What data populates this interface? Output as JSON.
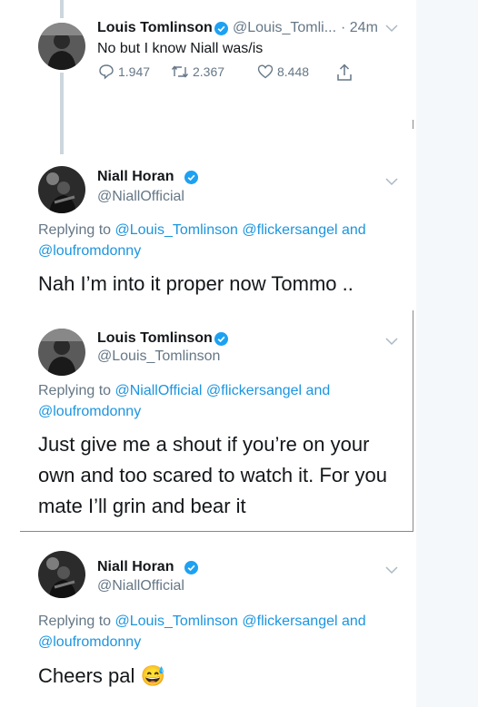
{
  "tweets": [
    {
      "name": "Louis Tomlinson",
      "handle": "@Louis_Tomli...",
      "time": "· 24m",
      "text": "No but I know Niall was/is",
      "actions": {
        "replies": "1.947",
        "retweets": "2.367",
        "likes": "8.448"
      }
    },
    {
      "name": "Niall Horan",
      "handle": "@NiallOfficial",
      "replying_prefix": "Replying to",
      "replying_to_1": "@Louis_Tomlinson",
      "replying_to_2": "@flickersangel",
      "replying_and": "and",
      "replying_to_3": "@loufromdonny",
      "text": "Nah I’m into it proper now Tommo .."
    },
    {
      "name": "Louis Tomlinson",
      "handle": "@Louis_Tomlinson",
      "replying_prefix": "Replying to",
      "replying_to_1": "@NiallOfficial",
      "replying_to_2": "@flickersangel",
      "replying_and": "and",
      "replying_to_3": "@loufromdonny",
      "text_lines": [
        "Just give me a shout if you’re on your",
        "own and too scared to watch it. For you",
        "mate I’ll grin and bear it"
      ]
    },
    {
      "name": "Niall Horan",
      "handle": "@NiallOfficial",
      "replying_prefix": "Replying to",
      "replying_to_1": "@Louis_Tomlinson",
      "replying_to_2": "@flickersangel",
      "replying_and": "and",
      "replying_to_3": "@loufromdonny",
      "text": "Cheers pal",
      "emoji": "😅"
    }
  ],
  "colors": {
    "link": "#1b95e0",
    "verified": "#1da1f2",
    "muted": "#657786"
  }
}
